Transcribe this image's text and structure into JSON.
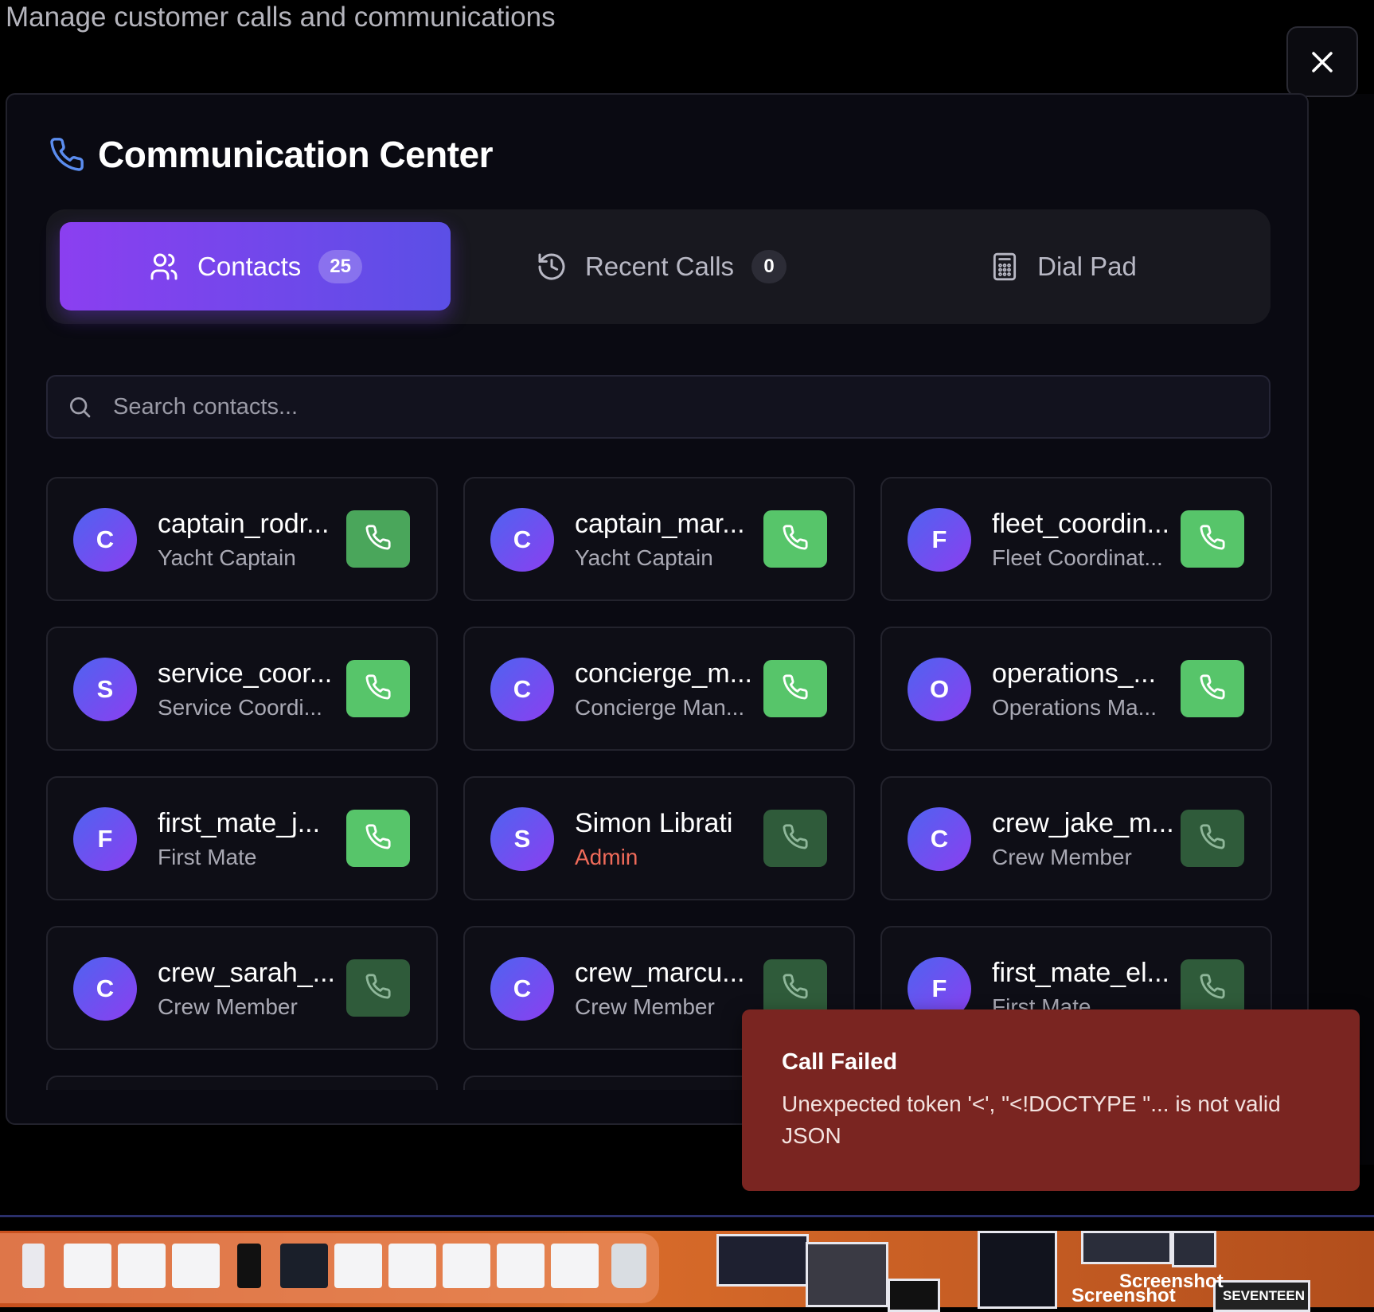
{
  "page": {
    "subtitle": "Manage customer calls and communications"
  },
  "modal": {
    "title": "Communication Center",
    "title_icon": "phone-icon",
    "close_icon": "close-icon"
  },
  "tabs": [
    {
      "label": "Contacts",
      "icon": "users-icon",
      "badge": "25",
      "active": true
    },
    {
      "label": "Recent Calls",
      "icon": "history-icon",
      "badge": "0",
      "active": false
    },
    {
      "label": "Dial Pad",
      "icon": "calculator-icon",
      "active": false
    }
  ],
  "search": {
    "placeholder": "Search contacts...",
    "value": ""
  },
  "contacts": [
    {
      "initial": "C",
      "name": "captain_rodr...",
      "role": "Yacht Captain",
      "call_enabled": true
    },
    {
      "initial": "C",
      "name": "captain_mar...",
      "role": "Yacht Captain",
      "call_enabled": true
    },
    {
      "initial": "F",
      "name": "fleet_coordin...",
      "role": "Fleet Coordinat...",
      "call_enabled": true
    },
    {
      "initial": "S",
      "name": "service_coor...",
      "role": "Service Coordi...",
      "call_enabled": true
    },
    {
      "initial": "C",
      "name": "concierge_m...",
      "role": "Concierge Man...",
      "call_enabled": true
    },
    {
      "initial": "O",
      "name": "operations_...",
      "role": "Operations Ma...",
      "call_enabled": true
    },
    {
      "initial": "F",
      "name": "first_mate_j...",
      "role": "First Mate",
      "call_enabled": true
    },
    {
      "initial": "S",
      "name": "Simon Librati",
      "role": "Admin",
      "call_enabled": false
    },
    {
      "initial": "C",
      "name": "crew_jake_m...",
      "role": "Crew Member",
      "call_enabled": false
    },
    {
      "initial": "C",
      "name": "crew_sarah_...",
      "role": "Crew Member",
      "call_enabled": false
    },
    {
      "initial": "C",
      "name": "crew_marcu...",
      "role": "Crew Member",
      "call_enabled": false
    },
    {
      "initial": "F",
      "name": "first_mate_el...",
      "role": "First Mate",
      "call_enabled": false
    }
  ],
  "toast": {
    "title": "Call Failed",
    "message": "Unexpected token '<', \"<!DOCTYPE \"... is not valid JSON"
  },
  "dock": {
    "labels": [
      "Screenshot",
      "Screenshot",
      "SEVENTEEN"
    ]
  },
  "colors": {
    "accent_gradient_start": "#8b3ff0",
    "accent_gradient_end": "#5b4fe6",
    "call_enabled": "#57c56a",
    "call_disabled": "#2f5b3a",
    "admin_role": "#f06b5a",
    "toast_bg": "#7a2521"
  }
}
